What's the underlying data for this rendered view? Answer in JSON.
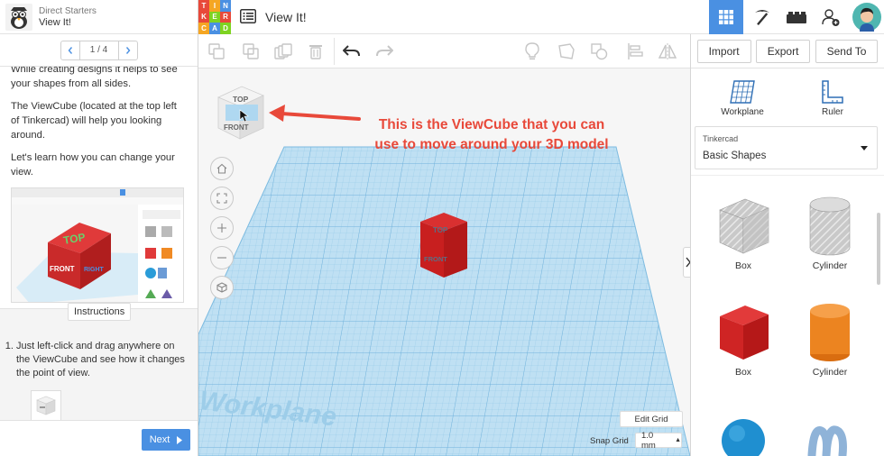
{
  "lesson": {
    "category": "Direct Starters",
    "title": "View It!",
    "page_indicator": "1 / 4",
    "paragraphs": [
      "While creating designs it helps to see your shapes from all sides.",
      "The ViewCube (located at the top left of Tinkercad) will help you looking around.",
      "Let's learn how you can change your view."
    ],
    "instructions_label": "Instructions",
    "instruction_items": [
      "Just left-click and drag anywhere on the ViewCube and see how it changes the point of view."
    ],
    "next_label": "Next"
  },
  "app": {
    "logo_letters": [
      "T",
      "I",
      "N",
      "K",
      "E",
      "R",
      "C",
      "A",
      "D"
    ],
    "logo_colors": [
      "#e8493a",
      "#f5a623",
      "#4a90e2",
      "#e8493a",
      "#7ed321",
      "#e8493a",
      "#f5a623",
      "#4a90e2",
      "#7ed321"
    ],
    "document_title": "View It!",
    "accent": "#4a90e2"
  },
  "toolbar": {
    "import_label": "Import",
    "export_label": "Export",
    "send_to_label": "Send To"
  },
  "tools": {
    "workplane_label": "Workplane",
    "ruler_label": "Ruler"
  },
  "library": {
    "source": "Tinkercad",
    "selected": "Basic Shapes"
  },
  "shapes": [
    {
      "label": "Box",
      "icon": "box-hole-icon"
    },
    {
      "label": "Cylinder",
      "icon": "cylinder-hole-icon"
    },
    {
      "label": "Box",
      "icon": "box-red-icon"
    },
    {
      "label": "Cylinder",
      "icon": "cylinder-orange-icon"
    }
  ],
  "workspace": {
    "annotation_line1": "This is the ViewCube that you can",
    "annotation_line2": "use to move around your 3D model",
    "viewcube_top": "TOP",
    "viewcube_front": "FRONT",
    "workplane_watermark": "Workplane",
    "edit_grid_label": "Edit Grid",
    "snap_grid_label": "Snap Grid",
    "snap_grid_value": "1.0 mm",
    "snap_caret": "▲"
  }
}
